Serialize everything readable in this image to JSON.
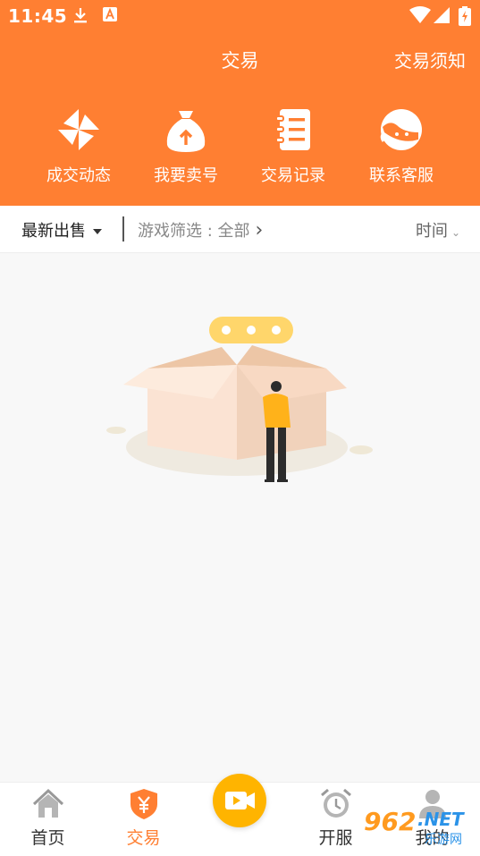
{
  "status_bar": {
    "time": "11:45"
  },
  "header": {
    "title": "交易",
    "notice_label": "交易须知",
    "background_color": "#ff7f32"
  },
  "quick_actions": [
    {
      "label": "成交动态",
      "icon": "pinwheel-icon"
    },
    {
      "label": "我要卖号",
      "icon": "money-bag-icon"
    },
    {
      "label": "交易记录",
      "icon": "record-book-icon"
    },
    {
      "label": "联系客服",
      "icon": "customer-service-icon"
    }
  ],
  "filter_bar": {
    "sort_label": "最新出售",
    "game_filter_label": "游戏筛选 : 全部",
    "time_label": "时间"
  },
  "empty_state": {
    "illustration": "empty-box-illustration"
  },
  "tab_bar": {
    "tabs": [
      {
        "label": "首页",
        "icon": "home-icon",
        "active": false
      },
      {
        "label": "交易",
        "icon": "yen-shield-icon",
        "active": true
      },
      {
        "label": "开服",
        "icon": "alarm-clock-icon",
        "active": false
      },
      {
        "label": "我的",
        "icon": "user-icon",
        "active": false
      }
    ],
    "center_button_icon": "video-camera-icon",
    "active_color": "#ff7f32",
    "center_button_color": "#ffb400"
  },
  "watermark": {
    "number": "962",
    "suffix": ".NET",
    "sub": "乐游网"
  }
}
